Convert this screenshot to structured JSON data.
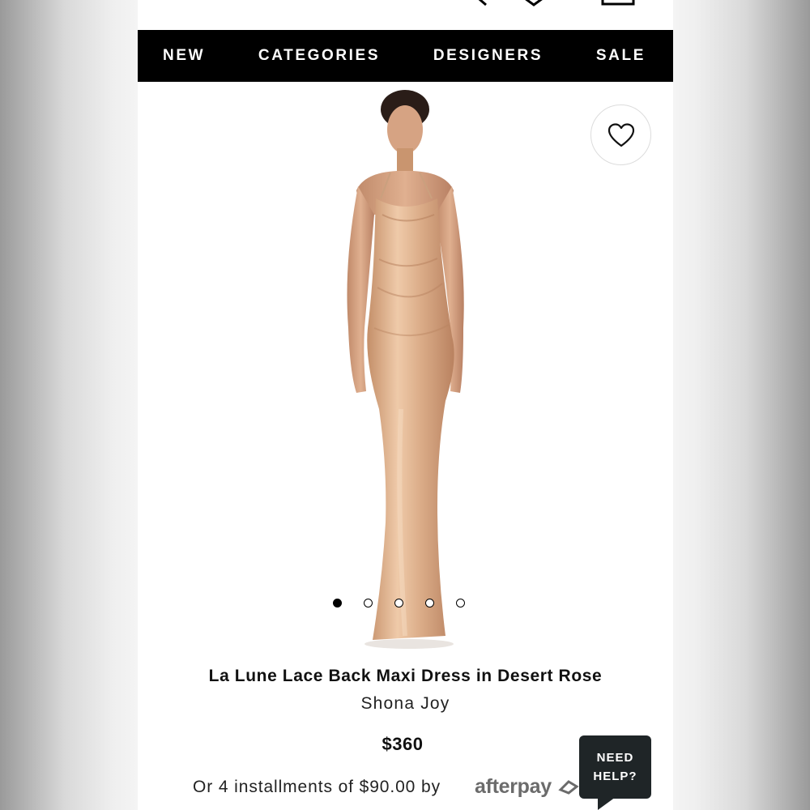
{
  "nav": {
    "items": [
      "NEW",
      "CATEGORIES",
      "DESIGNERS",
      "SALE"
    ]
  },
  "header_icons": [
    "search-icon",
    "heart-icon",
    "bag-icon"
  ],
  "product": {
    "title": "La Lune Lace Back Maxi Dress in Desert Rose",
    "designer": "Shona Joy",
    "price": "$360",
    "installments": "Or 4 installments of $90.00 by",
    "afterpay_logo": "afterpay",
    "image_count": 5,
    "active_image": 1
  },
  "help": {
    "line1": "NEED",
    "line2": "HELP?"
  },
  "colors": {
    "nav_bg": "#000000",
    "dress": "#d9a985",
    "help_bg": "#1f2527"
  }
}
